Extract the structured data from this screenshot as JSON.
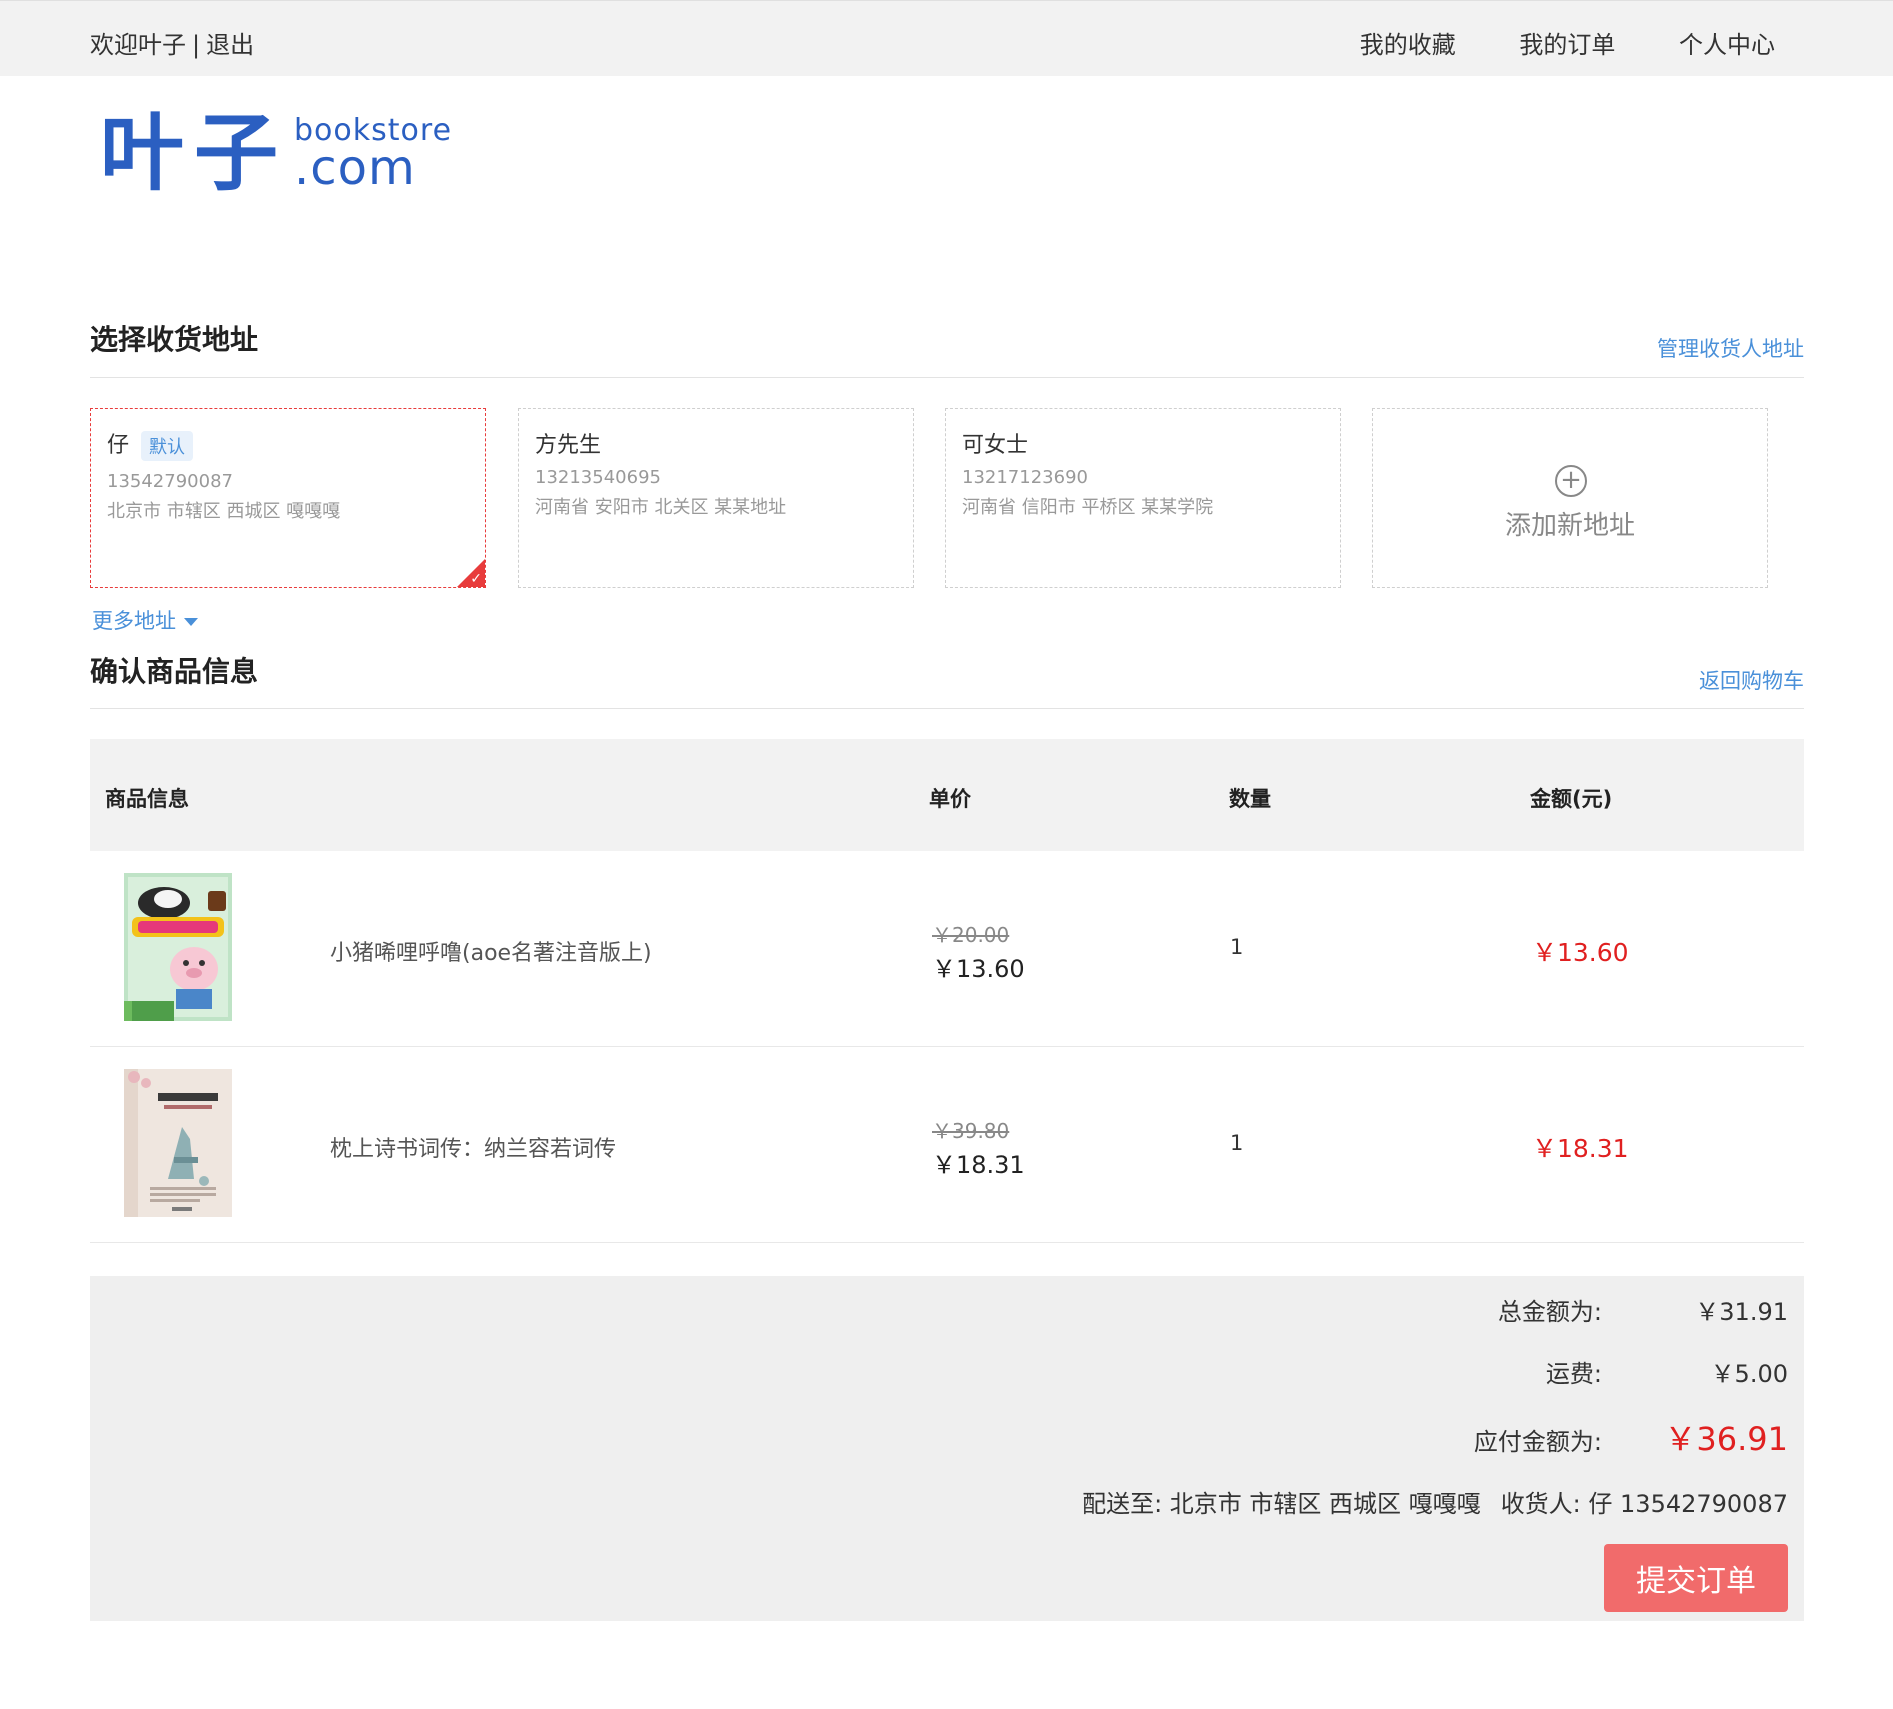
{
  "topbar": {
    "welcome": "欢迎叶子",
    "separator": "|",
    "logout": "退出",
    "nav": [
      "我的收藏",
      "我的订单",
      "个人中心"
    ]
  },
  "logo": {
    "cn": "叶子",
    "en_top": "bookstore",
    "en_bottom": ".com"
  },
  "address_section": {
    "title": "选择收货地址",
    "manage_link": "管理收货人地址",
    "more_label": "更多地址",
    "cards": [
      {
        "name": "仔",
        "badge": "默认",
        "phone": "13542790087",
        "address": "北京市 市辖区 西城区 嘎嘎嘎",
        "selected": true
      },
      {
        "name": "方先生",
        "phone": "13213540695",
        "address": "河南省 安阳市 北关区 某某地址",
        "selected": false
      },
      {
        "name": "可女士",
        "phone": "13217123690",
        "address": "河南省 信阳市 平桥区 某某学院",
        "selected": false
      }
    ],
    "add_label": "添加新地址",
    "add_icon": "plus-circle-icon"
  },
  "goods_section": {
    "title": "确认商品信息",
    "back_link": "返回购物车",
    "headers": [
      "商品信息",
      "单价",
      "数量",
      "金额(元)"
    ],
    "items": [
      {
        "title": "小猪唏哩呼噜(aoe名著注音版上)",
        "old_price": "￥20.00",
        "price": "￥13.60",
        "qty": "1",
        "amount": "￥13.60",
        "cover_icon": "book-cover-pig"
      },
      {
        "title": "枕上诗书词传：纳兰容若词传",
        "old_price": "￥39.80",
        "price": "￥18.31",
        "qty": "1",
        "amount": "￥18.31",
        "cover_icon": "book-cover-nalan"
      }
    ]
  },
  "summary": {
    "total_label": "总金额为:",
    "total_value": "￥31.91",
    "shipping_label": "运费:",
    "shipping_value": "￥5.00",
    "payable_label": "应付金额为:",
    "payable_value": "￥36.91",
    "ship_to": "配送至: 北京市 市辖区 西城区 嘎嘎嘎",
    "receiver": "收货人: 仔 13542790087",
    "submit_label": "提交订单"
  },
  "colors": {
    "accent_blue": "#4a90d9",
    "price_red": "#e02020",
    "submit_bg": "#f16b6b",
    "logo_blue": "#2b5fc1"
  }
}
